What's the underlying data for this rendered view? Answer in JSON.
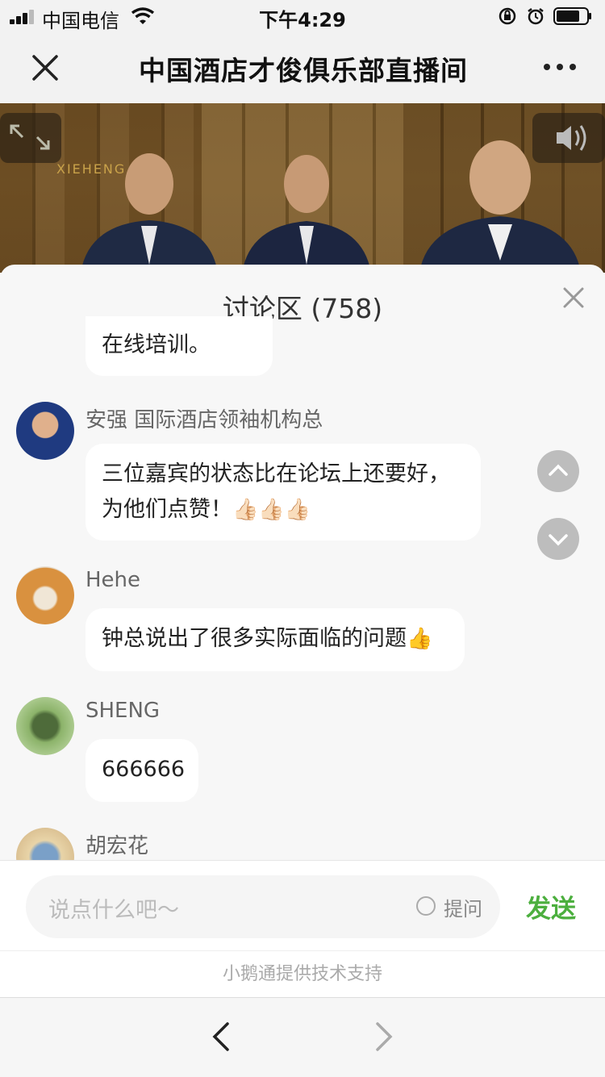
{
  "status_bar": {
    "carrier": "中国电信",
    "time": "下午4:29"
  },
  "nav": {
    "title": "中国酒店才俊俱乐部直播间"
  },
  "video": {
    "logo_text": "XIEHENG"
  },
  "discussion": {
    "title": "讨论区 (758)",
    "partial_message": "在线培训。",
    "messages": [
      {
        "name": "安强  国际酒店领袖机构总",
        "text": "三位嘉宾的状态比在论坛上还要好，为他们点赞！",
        "emoji": "👍🏻👍🏻👍🏻"
      },
      {
        "name": "Hehe",
        "text": "钟总说出了很多实际面临的问题",
        "emoji": "👍"
      },
      {
        "name": "SHENG",
        "text": "666666"
      },
      {
        "name": "胡宏花"
      }
    ]
  },
  "input": {
    "placeholder": "说点什么吧～",
    "ask_label": "提问",
    "send_label": "发送"
  },
  "footer": {
    "powered_by": "小鹅通提供技术支持"
  },
  "colors": {
    "accent": "#4caf3e",
    "bubble": "#ffffff",
    "sheet_bg": "#f7f7f7"
  }
}
